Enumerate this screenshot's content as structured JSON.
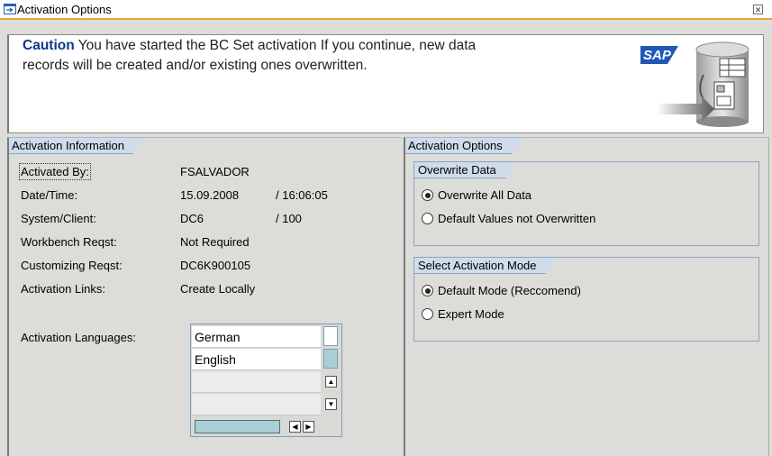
{
  "window": {
    "title": "Activation Options"
  },
  "message": {
    "caution_label": "Caution",
    "text_line1": " You have started the BC Set activation If you continue, new data",
    "text_line2": "records will be created and/or existing ones overwritten."
  },
  "activation_info": {
    "heading": "Activation Information",
    "rows": [
      {
        "label": "Activated By:",
        "value": "FSALVADOR"
      },
      {
        "label": "Date/Time:",
        "value": "15.09.2008",
        "value2": "/ 16:06:05"
      },
      {
        "label": "System/Client:",
        "value": "DC6",
        "value2": "/ 100"
      },
      {
        "label": "Workbench Reqst:",
        "value": "Not Required"
      },
      {
        "label": "Customizing Reqst:",
        "value": "DC6K900105"
      },
      {
        "label": "Activation Links:",
        "value": "Create Locally"
      }
    ],
    "languages_label": "Activation Languages:",
    "languages": [
      "German",
      "English",
      "",
      ""
    ]
  },
  "activation_options": {
    "heading": "Activation Options",
    "overwrite": {
      "heading": "Overwrite Data",
      "options": [
        {
          "label": "Overwrite All Data",
          "selected": true
        },
        {
          "label": "Default Values not Overwritten",
          "selected": false
        }
      ]
    },
    "mode": {
      "heading": "Select Activation Mode",
      "options": [
        {
          "label": "Default Mode (Reccomend)",
          "selected": true
        },
        {
          "label": "Expert Mode",
          "selected": false
        }
      ]
    }
  },
  "icons": {
    "title": "window-arrow-icon",
    "close": "close-icon",
    "brand": "sap-logo"
  },
  "colors": {
    "accent": "#e8a33d",
    "header_tab": "#cfdcec",
    "caution_text": "#0b3a8a",
    "background": "#dcdcd8"
  }
}
